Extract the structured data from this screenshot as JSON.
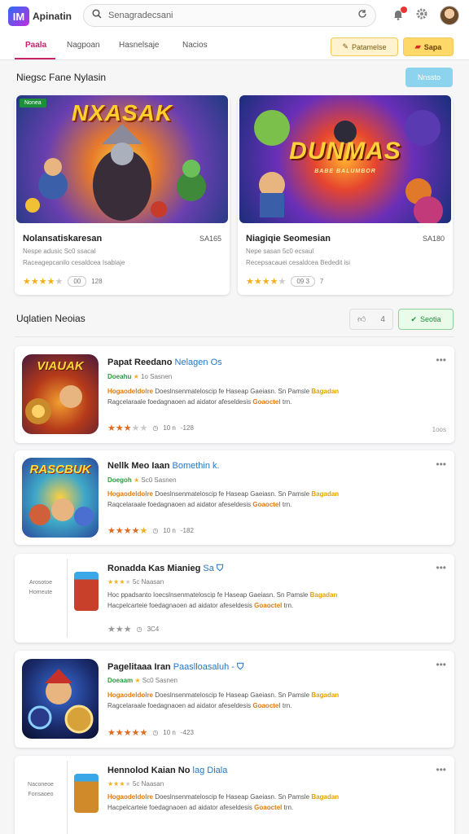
{
  "app": {
    "logo_text": "IM",
    "name": "Apinatin"
  },
  "search": {
    "placeholder": "Senagradecsani"
  },
  "tabs": [
    {
      "label": "Paala",
      "active": true
    },
    {
      "label": "Nagpoan",
      "active": false
    },
    {
      "label": "Hasnelsaje",
      "active": false
    },
    {
      "label": "Nacios",
      "active": false
    }
  ],
  "toolbar": {
    "button1": "Patamelse",
    "button2": "Sapa"
  },
  "featured": {
    "title": "Niegsc Fane Nylasin",
    "action": "Nnssto",
    "cards": [
      {
        "badge": "Nonea",
        "art_title": "NXASAK",
        "name": "Nolansatiskaresan",
        "price": "SA165",
        "desc1": "Nespe adusic Sc0 ssacal",
        "desc2": "Raceagepcanilo cesaldcea Isabiaje",
        "rating": 4,
        "pill": "00",
        "count": "128"
      },
      {
        "badge": "",
        "art_title": "DUNMAS",
        "art_subtitle": "BABE BALUMBOR",
        "name": "Niagiqie Seomesian",
        "price": "SA180",
        "desc1": "Nepe sasan 5c0 ecsaul",
        "desc2": "Recepsacauei cesaldcea Bededit isi",
        "rating": 4,
        "pill": "09 3",
        "count": "7"
      }
    ]
  },
  "updates": {
    "title": "Uqlatien Neoias",
    "filter_icon": "thumbs-icon",
    "filter_count": "4",
    "action": "Seotia",
    "items": [
      {
        "thumb_text": "VIAUAK",
        "title": "Papat Reedano",
        "title_blue": "Nelagen Os",
        "sub_green": "Doeahu",
        "sub_rest": "1o Sasnen",
        "line1_o": "Hogaodeldolre",
        "line1": "Doeslnsenmateloscip fe Haseap Gaeiasn. Sn Pamsle",
        "line1_y": "Bagadan",
        "line2": "Ragcelaraale foedagnaoen ad aidator afeseldesis",
        "line2_o": "Goaoctel",
        "line2_end": "trn.",
        "rating": 3,
        "meta1": "10 n",
        "meta2": "-128",
        "corner": "1oos"
      },
      {
        "thumb_text": "RASCBUK",
        "title": "Nellk Meo Iaan",
        "title_blue": "Bomethin k.",
        "sub_green": "Doegoh",
        "sub_rest": "Sc0 Sasnen",
        "line1_o": "Hogaodeldolre",
        "line1": "Doeslnsenmateloscip fe Haseap Gaeiasn. Sn Pamsle",
        "line1_y": "Bagadan",
        "line2": "Raqcelaraale foedagnaoen ad aidator afeseldesis",
        "line2_o": "Goaoctel",
        "line2_end": "trn.",
        "rating": 4,
        "meta1": "10 n",
        "meta2": "-182",
        "corner": ""
      },
      {
        "left_text": "Arosotoe Homeute",
        "title": "Ronadda Kas Mianieg",
        "title_blue": "Sa",
        "sub_green": "",
        "sub_rest": "5c Naasan",
        "line1_o": "",
        "line1": "Hoc ppadsanto Ioecslnsenmateloscip fe Haseap Gaeiasn. Sn Pamsle",
        "line1_y": "Bagadan",
        "line2": "Hacpelcarteie foedagnaoen ad aidator afeseldesis",
        "line2_o": "Goaoctel",
        "line2_end": "trn.",
        "rating": 3,
        "meta1": "",
        "meta2": "3C4",
        "corner": ""
      },
      {
        "thumb_text": "",
        "title": "Pagelitaaa Iran",
        "title_blue": "Paaslloasaluh -",
        "sub_green": "Doeaam",
        "sub_rest": "Sc0 Sasnen",
        "line1_o": "Hogaodeldolre",
        "line1": "Doeslnsenmateloscip fe Haseap Gaeiasn. Sn Pamsle",
        "line1_y": "Bagadan",
        "line2": "Ragcelaraale foedagnaoen ad aidator afeseldesis",
        "line2_o": "Goaoctel",
        "line2_end": "trn.",
        "rating": 5,
        "meta1": "10 n",
        "meta2": "-423",
        "corner": ""
      },
      {
        "left_text": "Naconeoe Fonsaoeo",
        "title": "Hennolod Kaian No",
        "title_blue": "lag  Diala",
        "sub_green": "",
        "sub_rest": "5c Naasan",
        "line1_o": "Hogaodeldolre",
        "line1": "Doeslnsenmateloscip fe Haseap Gaeiasn. Sn Pamsle",
        "line1_y": "Bagadan",
        "line2": "Hacpelcarteie foedagnaoen ad aidator afeseldesis",
        "line2_o": "Goaoctel",
        "line2_end": "trn.",
        "rating": 3,
        "meta1": "",
        "meta2": "",
        "corner": ""
      }
    ]
  },
  "colors": {
    "accent": "#c8246a",
    "star": "#f2b01e",
    "green": "#1d8f3a",
    "blue_button": "#8cd4ee",
    "toolbar_yellow": "#ffd86a"
  }
}
